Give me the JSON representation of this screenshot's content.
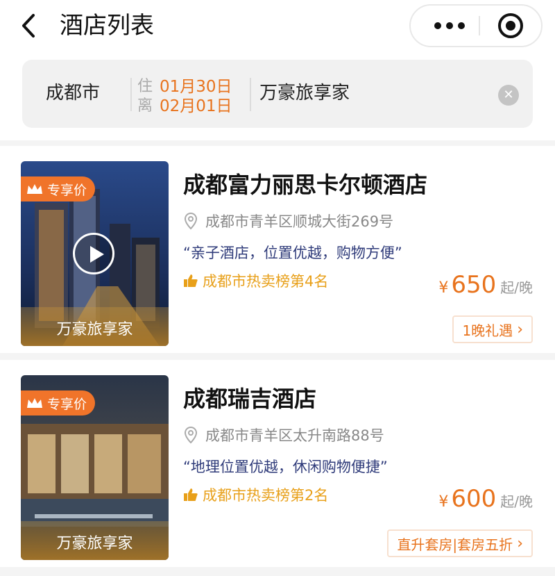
{
  "header": {
    "title": "酒店列表",
    "back_icon": "chevron-left-icon",
    "more_icon": "more-dots-icon",
    "close_icon": "target-circle-icon"
  },
  "search": {
    "city": "成都市",
    "checkin_label": "住",
    "checkin_date": "01月30日",
    "checkout_label": "离",
    "checkout_date": "02月01日",
    "keyword": "万豪旅享家",
    "clear_icon": "clear-x-icon"
  },
  "hotels": [
    {
      "badge": "专享价",
      "brand": "万豪旅享家",
      "name": "成都富力丽思卡尔顿酒店",
      "address": "成都市青羊区顺城大街269号",
      "quote": "“亲子酒店，位置优越，购物方便”",
      "rank": "成都市热卖榜第4名",
      "currency": "¥",
      "price": "650",
      "unit": "起/晚",
      "perk": "1晚礼遇",
      "has_video": true
    },
    {
      "badge": "专享价",
      "brand": "万豪旅享家",
      "name": "成都瑞吉酒店",
      "address": "成都市青羊区太升南路88号",
      "quote": "“地理位置优越，休闲购物便捷”",
      "rank": "成都市热卖榜第2名",
      "currency": "¥",
      "price": "600",
      "unit": "起/晚",
      "perk": "直升套房|套房五折",
      "has_video": false
    }
  ],
  "colors": {
    "accent": "#e8731d",
    "rank": "#e8a01a",
    "quote": "#2f3b7a",
    "badge": "#f0742a"
  }
}
